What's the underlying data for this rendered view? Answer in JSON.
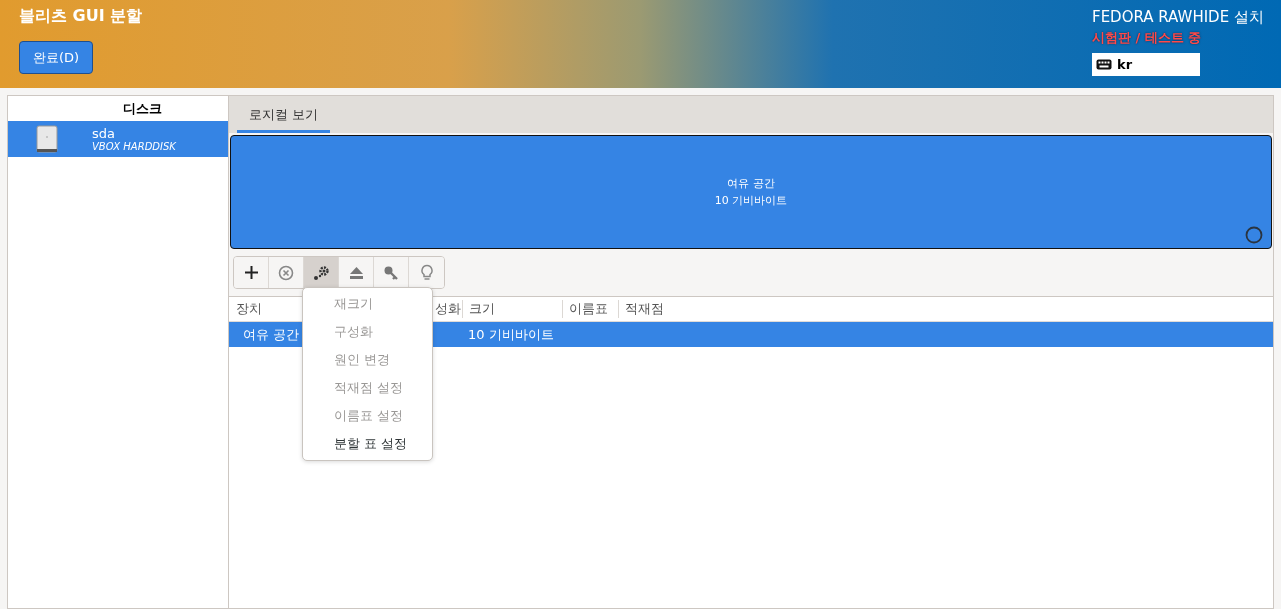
{
  "header": {
    "title": "블리츠 GUI 분할",
    "done_button": "완료(D)",
    "product": "FEDORA RAWHIDE 설치",
    "warning": "시험판 / 테스트 중",
    "keyboard": "kr"
  },
  "sidebar": {
    "heading": "디스크",
    "items": [
      {
        "name": "sda",
        "model": "VBOX HARDDISK",
        "selected": true
      }
    ]
  },
  "tabs": [
    {
      "label": "로지컬 보기",
      "selected": true
    }
  ],
  "partition_bar": {
    "label": "여유 공간",
    "size": "10 기비바이트"
  },
  "toolbar": [
    {
      "kind": "add",
      "selected": false
    },
    {
      "kind": "remove",
      "selected": false
    },
    {
      "kind": "configure",
      "selected": true
    },
    {
      "kind": "eject",
      "selected": false
    },
    {
      "kind": "key",
      "selected": false
    },
    {
      "kind": "bulb",
      "selected": false
    }
  ],
  "table": {
    "columns": [
      "장치",
      "성화",
      "크기",
      "이름표",
      "적재점"
    ],
    "rows": [
      {
        "cells": [
          "여유 공간",
          "",
          "10 기비바이트",
          "",
          ""
        ],
        "selected": true
      }
    ]
  },
  "menu": {
    "items": [
      {
        "label": "재크기",
        "disabled": true
      },
      {
        "label": "구성화",
        "disabled": true
      },
      {
        "label": "원인 변경",
        "disabled": true
      },
      {
        "label": "적재점 설정",
        "disabled": true
      },
      {
        "label": "이름표 설정",
        "disabled": true
      },
      {
        "label": "분할 표 설정",
        "disabled": false
      }
    ]
  }
}
